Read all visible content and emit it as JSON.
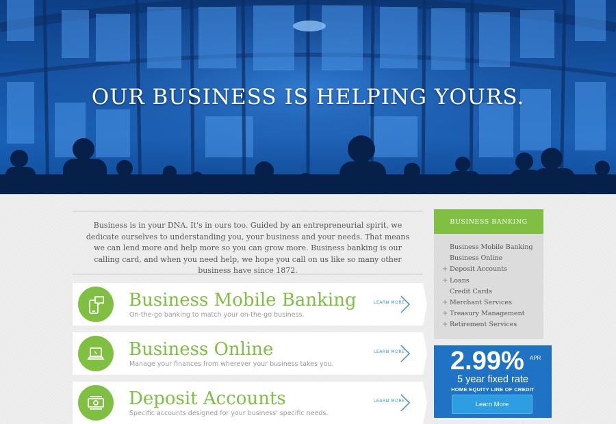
{
  "hero": {
    "title": "OUR BUSINESS IS HELPING YOURS."
  },
  "intro": {
    "text": "Business is in your DNA. It's in ours too. Guided by an entrepreneurial spirit, we dedicate ourselves to understanding you, your business and your needs. That means we can lend more and help more so you can grow more. Business banking is our calling card, and when you need help, we hope you call on us like so many other business have since 1872."
  },
  "features": [
    {
      "title": "Business Mobile Banking",
      "desc": "On-the-go banking to match your on-the-go business.",
      "link": "LEARN MORE",
      "icon": "mobile-chat-icon"
    },
    {
      "title": "Business Online",
      "desc": "Manage your finances from wherever your business takes you.",
      "link": "LEARN MORE",
      "icon": "laptop-icon"
    },
    {
      "title": "Deposit Accounts",
      "desc": "Specific accounts designed for your business' specific needs.",
      "link": "LEARN MORE",
      "icon": "money-icon"
    }
  ],
  "sidebar": {
    "heading": "BUSINESS BANKING",
    "items": [
      {
        "label": "Business Mobile Banking",
        "expandable": false
      },
      {
        "label": "Business Online",
        "expandable": false
      },
      {
        "label": "Deposit Accounts",
        "expandable": true
      },
      {
        "label": "Loans",
        "expandable": true
      },
      {
        "label": "Credit Cards",
        "expandable": false
      },
      {
        "label": "Merchant Services",
        "expandable": true
      },
      {
        "label": "Treasury Management",
        "expandable": true
      },
      {
        "label": "Retirement Services",
        "expandable": true
      }
    ]
  },
  "promo": {
    "rate": "2.99%",
    "apr": "APR",
    "term": "5 year fixed rate",
    "product": "HOME EQUITY LINE OF CREDIT",
    "button": "Learn More"
  },
  "colors": {
    "accent_green": "#7fc043",
    "link_blue": "#3a8fd0",
    "promo_blue": "#1f72c4"
  }
}
